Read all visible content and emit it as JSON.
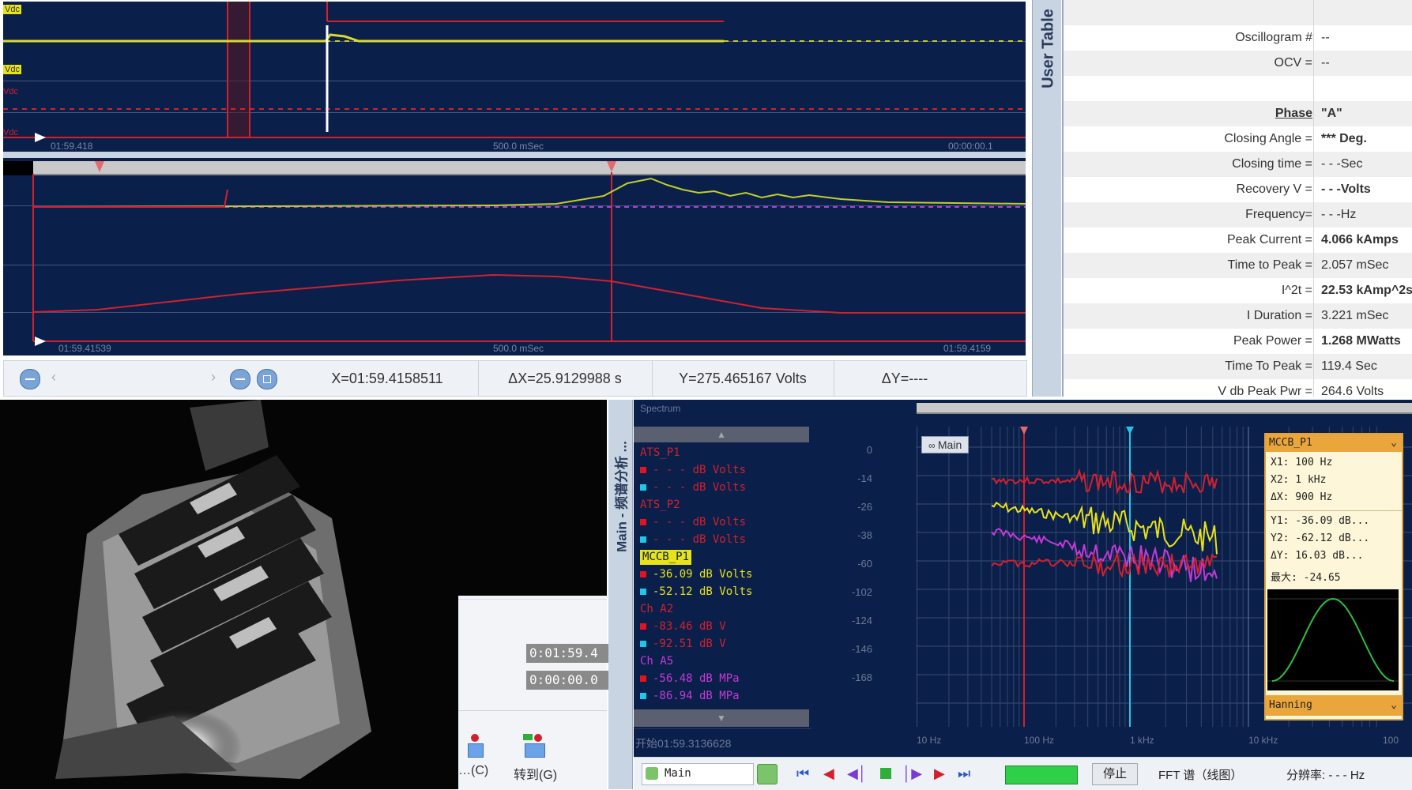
{
  "top_scope": {
    "y_tags": [
      "Vdc",
      "Vdc",
      "Vdc",
      "Vdc"
    ],
    "x_ticks": [
      "01:59.418",
      "500.0 mSec",
      "00:00:00.1"
    ],
    "colors": {
      "yellow": "#d7dc2a",
      "red": "#d3202e",
      "white": "#ffffff",
      "bg": "#0a1f4a"
    }
  },
  "mid_scope": {
    "x_ticks": [
      "01:59.41539",
      "500.0 mSec",
      "01:59.4159"
    ]
  },
  "status_bar": {
    "x_readout": "X=01:59.4158511",
    "dx_readout": "ΔX=25.9129988 s",
    "y_readout": "Y=275.465167 Volts",
    "dy_readout": "ΔY=----"
  },
  "user_table": {
    "tab_label": "User Table",
    "rows": [
      {
        "label": "",
        "value": ""
      },
      {
        "label": "Oscillogram #",
        "value": "--"
      },
      {
        "label": "OCV =",
        "value": "--"
      },
      {
        "label": "",
        "value": ""
      },
      {
        "label": "Phase",
        "value": "\"A\"",
        "bold": true
      },
      {
        "label": "Closing Angle =",
        "value": "*** Deg.",
        "bold_value": true
      },
      {
        "label": "Closing time =",
        "value": "- - -Sec"
      },
      {
        "label": "Recovery V =",
        "value": "- - -Volts",
        "bold_value": true
      },
      {
        "label": "Frequency=",
        "value": "- - -Hz"
      },
      {
        "label": "Peak Current =",
        "value": "4.066 kAmps",
        "bold_value": true
      },
      {
        "label": "Time to Peak =",
        "value": "2.057 mSec"
      },
      {
        "label": "I^2t =",
        "value": "22.53 kAmp^2sec",
        "bold_value": true
      },
      {
        "label": "I Duration =",
        "value": "3.221 mSec"
      },
      {
        "label": "Peak Power =",
        "value": "1.268 MWatts",
        "bold_value": true
      },
      {
        "label": "Time To Peak =",
        "value": "119.4 Sec"
      },
      {
        "label": "V db Peak Pwr =",
        "value": "264.6 Volts"
      }
    ]
  },
  "video_panel": {
    "time1": "0:01:59.4",
    "time2": "0:00:00.0",
    "btn1_label": "…(C)",
    "btn2_label": "转到(G)"
  },
  "fft_panel": {
    "side_tab": "Main - 频谱分析 ...",
    "header_left": "Spectrum",
    "main_badge": "Main",
    "legend": [
      {
        "text": "ATS_P1",
        "color": "#d3202e",
        "heading": true
      },
      {
        "text": "- - - dB Volts",
        "color": "#d3202e",
        "marker": "#e3131f"
      },
      {
        "text": "- - - dB Volts",
        "color": "#d3202e",
        "marker": "#21c6e8"
      },
      {
        "text": "ATS_P2",
        "color": "#d3202e",
        "heading": true
      },
      {
        "text": "- - - dB Volts",
        "color": "#d3202e",
        "marker": "#e3131f"
      },
      {
        "text": "- - - dB Volts",
        "color": "#d3202e",
        "marker": "#21c6e8"
      },
      {
        "text": "MCCB_P1",
        "color": "#0a1f4a",
        "heading": true,
        "highlight": "#e8e21b"
      },
      {
        "text": "-36.09 dB Volts",
        "color": "#e8e21b",
        "marker": "#e3131f"
      },
      {
        "text": "-52.12 dB Volts",
        "color": "#e8e21b",
        "marker": "#21c6e8"
      },
      {
        "text": "Ch A2",
        "color": "#d3202e",
        "heading": true
      },
      {
        "text": "-83.46 dB V",
        "color": "#d3202e",
        "marker": "#e3131f"
      },
      {
        "text": "-92.51 dB V",
        "color": "#d3202e",
        "marker": "#21c6e8"
      },
      {
        "text": "Ch A5",
        "color": "#c43ad6",
        "heading": true
      },
      {
        "text": "-56.48 dB MPa",
        "color": "#c43ad6",
        "marker": "#e3131f"
      },
      {
        "text": "-86.94 dB MPa",
        "color": "#c43ad6",
        "marker": "#21c6e8"
      }
    ],
    "cursor_readout": "开始01:59.3136628",
    "y_ticks": [
      "0",
      "-14",
      "-26",
      "-38",
      "-60",
      "-102",
      "-124",
      "-146",
      "-168"
    ],
    "x_ticks": [
      "10 Hz",
      "100 Hz",
      "1 kHz",
      "10 kHz",
      "100"
    ],
    "cursor_box": {
      "title": "MCCB_P1",
      "x1": "X1: 100 Hz",
      "x2": "X2: 1 kHz",
      "dx": "ΔX: 900 Hz",
      "y1": "Y1: -36.09 dB...",
      "y2": "Y2: -62.12 dB...",
      "dy": "ΔY: 16.03 dB...",
      "max": "最大: -24.65",
      "window": "Hanning"
    },
    "toolbar": {
      "source": "Main",
      "stop_label": "停止",
      "fft_label": "FFT 谱（线图）",
      "resolution_label": "分辨率: - - - Hz"
    }
  }
}
